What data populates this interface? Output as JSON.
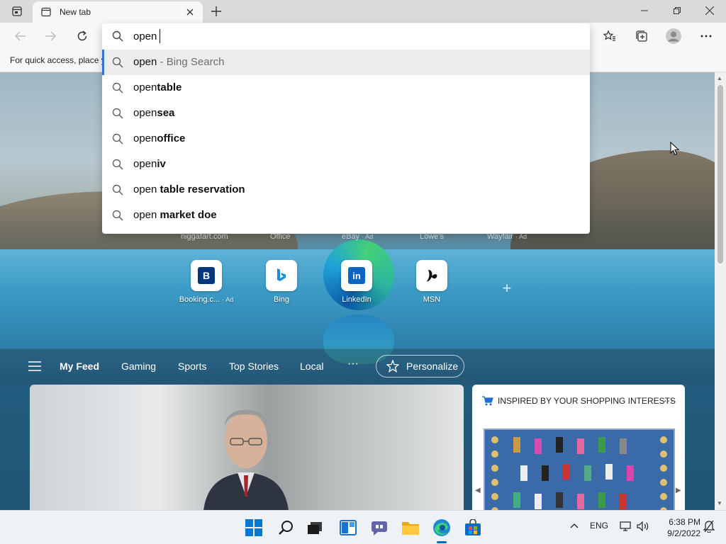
{
  "browser": {
    "tab": {
      "title": "New tab"
    },
    "favorites_bar_text": "For quick access, place y"
  },
  "omnibox": {
    "value": "open",
    "suggestions": [
      {
        "typed": "open",
        "rest": "",
        "hint": " - Bing Search"
      },
      {
        "typed": "open",
        "rest": "table",
        "hint": ""
      },
      {
        "typed": "open",
        "rest": "sea",
        "hint": ""
      },
      {
        "typed": "open",
        "rest": "office",
        "hint": ""
      },
      {
        "typed": "open",
        "rest": "iv",
        "hint": ""
      },
      {
        "typed": "open",
        "rest": " table reservation",
        "hint": ""
      },
      {
        "typed": "open",
        "rest": " market doe",
        "hint": ""
      }
    ]
  },
  "top_sites_faded": [
    {
      "label": "niggafart.com"
    },
    {
      "label": "Office"
    },
    {
      "label": "eBay",
      "ad": "· Ad"
    },
    {
      "label": "Lowe's"
    },
    {
      "label": "Wayfair",
      "ad": "· Ad"
    }
  ],
  "top_sites": [
    {
      "label": "Booking.c...",
      "ad": "· Ad",
      "glyph": "B",
      "color": "#003580"
    },
    {
      "label": "Bing",
      "ad": "",
      "glyph": "b",
      "color": "#0c8484"
    },
    {
      "label": "LinkedIn",
      "ad": "",
      "glyph": "in",
      "color": "#0a66c2"
    },
    {
      "label": "MSN",
      "ad": "",
      "glyph": "✶",
      "color": "#111111"
    }
  ],
  "feed": {
    "items": [
      "My Feed",
      "Gaming",
      "Sports",
      "Top Stories",
      "Local"
    ],
    "more": "···",
    "personalize": "Personalize"
  },
  "shopping_card": {
    "title": "INSPIRED BY YOUR SHOPPING INTERESTS",
    "more": "···"
  },
  "taskbar": {
    "language": "ENG",
    "time": "6:38 PM",
    "date": "9/2/2022"
  },
  "colors": {
    "accent": "#0067c0",
    "selection_bar": "#3874c8"
  }
}
